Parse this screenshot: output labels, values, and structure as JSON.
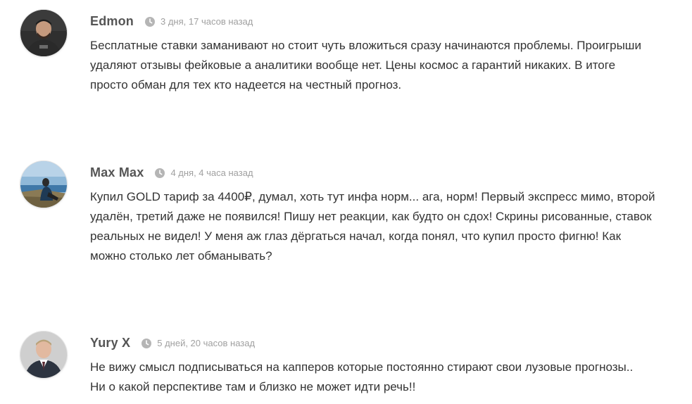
{
  "comments": [
    {
      "author": "Edmon",
      "time": "3 дня, 17 часов назад",
      "avatar": "avatar-man-dark-shirt",
      "lines": [
        "Бесплатные ставки заманивают но стоит чуть вложиться сразу начинаются проблемы. Проигрыши",
        "удаляют отзывы фейковые а аналитики вообще нет. Цены космос а гарантий никаких. В итоге",
        "просто обман для тех кто надеется на честный прогноз."
      ]
    },
    {
      "author": "Max Max",
      "time": "4 дня, 4 часа назад",
      "avatar": "avatar-seaside-photo",
      "lines": [
        "Купил GOLD тариф за 4400₽, думал, хоть тут инфа норм... ага, норм! Первый экспресс мимо, второй",
        "удалён, третий даже не появился! Пишу нет реакции, как будто он сдох! Скрины рисованные, ставок",
        "реальных не видел! У меня аж глаз дёргаться начал, когда понял, что купил просто фигню! Как",
        "можно столько лет обманывать?"
      ]
    },
    {
      "author": "Yury X",
      "time": "5 дней, 20 часов назад",
      "avatar": "avatar-man-suit",
      "lines": [
        "Не вижу смысл подписываться на капперов которые постоянно стирают свои лузовые прогнозы..",
        "Ни о какой перспективе там и близко не может идти речь!!"
      ]
    }
  ],
  "icons": {
    "time": "clock-icon"
  },
  "colors": {
    "author": "#555555",
    "time": "#a0a0a0",
    "text": "#333333",
    "clock": "#b5b5b5"
  }
}
